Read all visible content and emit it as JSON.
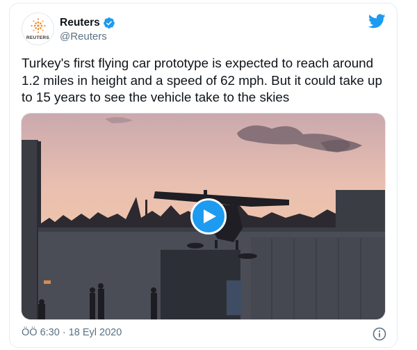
{
  "author": {
    "display_name": "Reuters",
    "handle": "@Reuters",
    "logo_text": "REUTERS",
    "verified": true
  },
  "tweet": {
    "text": "Turkey's first flying car prototype is expected to reach around 1.2 miles in height and a speed of 62 mph. But it could take up to 15 years to see the vehicle take to the skies"
  },
  "media": {
    "type": "video",
    "play_icon": "play-icon"
  },
  "footer": {
    "timestamp": "ÖÖ 6:30 · 18 Eyl 2020"
  },
  "colors": {
    "accent": "#1d9bf0",
    "secondary_text": "#5b7083",
    "logo_orange": "#f28c28"
  },
  "icons": {
    "brand": "twitter-bird-icon",
    "verified": "verified-badge-icon",
    "info": "info-icon"
  }
}
